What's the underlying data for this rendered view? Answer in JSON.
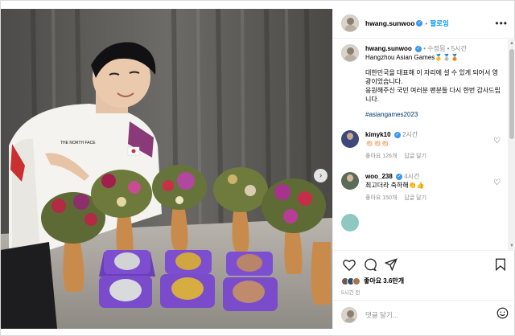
{
  "post": {
    "username": "hwang.sunwoo",
    "follow_label": "팔로잉",
    "separator": "•"
  },
  "caption": {
    "username": "hwang.sunwoo",
    "edited_label": "수정됨",
    "time": "5시간",
    "title_line": "Hangzhou Asian Games🥇🥈🥉",
    "line1": "대한민국을 대표해 이 자리에 설 수 있게 되어서 영광이었습니다.",
    "line2": "응원해주신 국민 여러분 팬분들 다시 한번 감사드립니다.",
    "hashtag": "#asiangames2023"
  },
  "comments": [
    {
      "username": "kimyk10",
      "time": "2시간",
      "text": "👏🏻👏🏻👏🏻",
      "likes": "좋아요 126개",
      "reply": "답글 달기"
    },
    {
      "username": "woo_238",
      "time": "4시간",
      "text": "최고더라 축하해👏👍",
      "likes": "좋아요 150개",
      "reply": "답글 달기"
    }
  ],
  "actions": {
    "likes_text": "좋아요 3.6만개",
    "timestamp": "5시간 전"
  },
  "comment_box": {
    "placeholder": "댓글 달기..."
  },
  "icons": {
    "more": "more-horizontal-icon",
    "like": "heart-icon",
    "comment": "comment-bubble-icon",
    "share": "paper-plane-icon",
    "save": "bookmark-icon",
    "emoji": "smiley-icon",
    "next": "chevron-right-icon"
  },
  "colors": {
    "accent": "#0095f6",
    "verified": "#3897f0",
    "muted": "#8e8e8e",
    "hashtag": "#00376b"
  }
}
